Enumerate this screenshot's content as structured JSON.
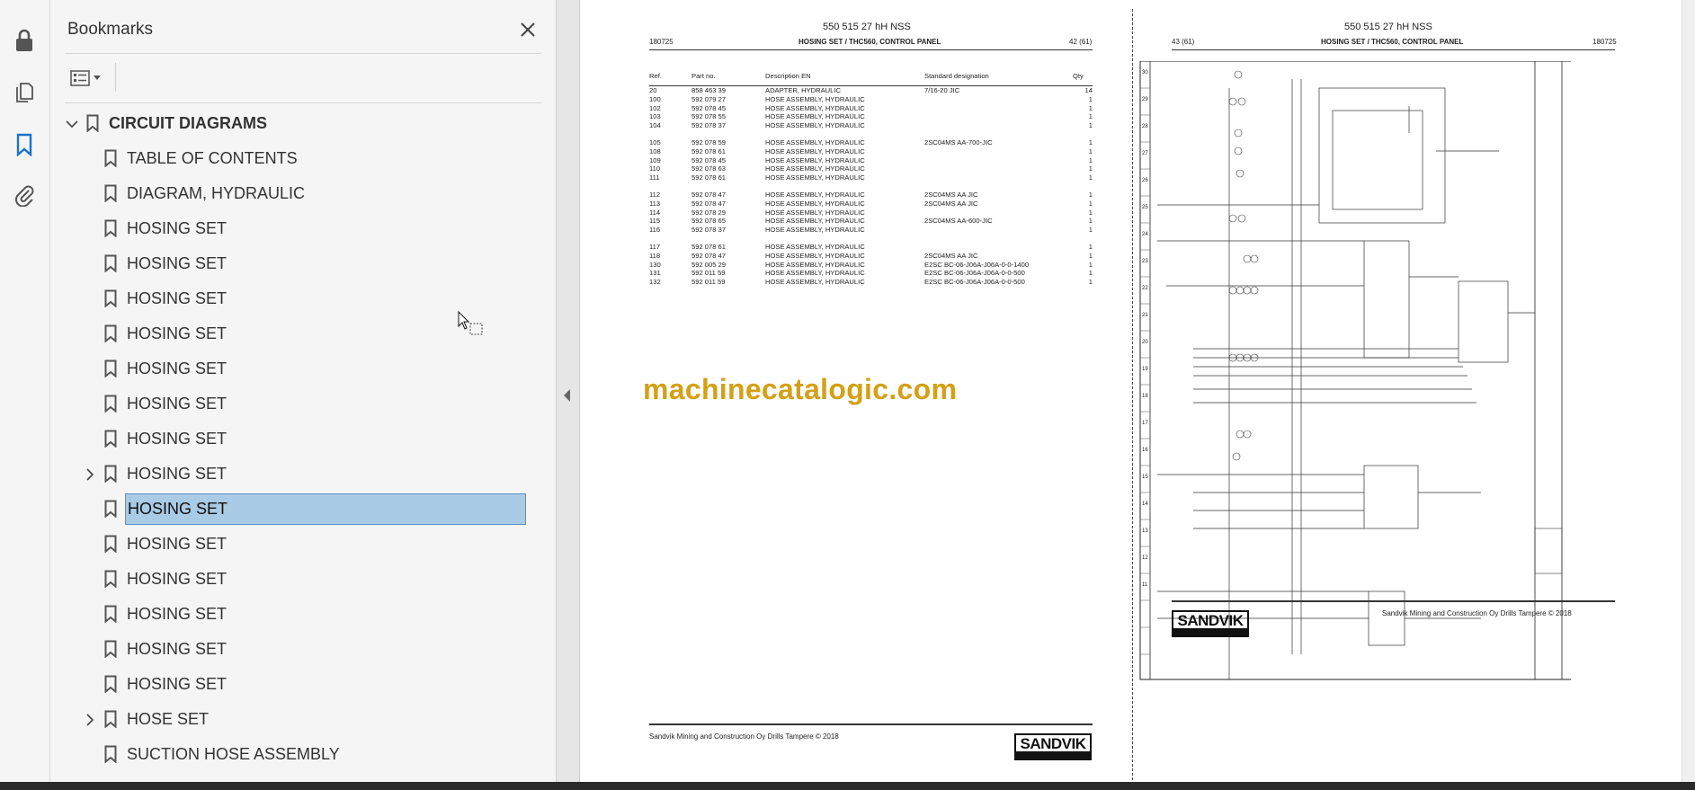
{
  "bookmarks_panel": {
    "title": "Bookmarks",
    "items": [
      {
        "label": "CIRCUIT DIAGRAMS",
        "level": 0,
        "expandable": true,
        "expanded": true
      },
      {
        "label": "TABLE OF CONTENTS",
        "level": 1
      },
      {
        "label": "DIAGRAM, HYDRAULIC",
        "level": 1
      },
      {
        "label": "HOSING SET",
        "level": 1
      },
      {
        "label": "HOSING SET",
        "level": 1
      },
      {
        "label": "HOSING SET",
        "level": 1
      },
      {
        "label": "HOSING SET",
        "level": 1
      },
      {
        "label": "HOSING SET",
        "level": 1
      },
      {
        "label": "HOSING SET",
        "level": 1
      },
      {
        "label": "HOSING SET",
        "level": 1
      },
      {
        "label": "HOSING SET",
        "level": 1,
        "expandable": true
      },
      {
        "label": "HOSING SET",
        "level": 1,
        "selected": true
      },
      {
        "label": "HOSING SET",
        "level": 1
      },
      {
        "label": "HOSING SET",
        "level": 1
      },
      {
        "label": "HOSING SET",
        "level": 1
      },
      {
        "label": "HOSING SET",
        "level": 1
      },
      {
        "label": "HOSING SET",
        "level": 1
      },
      {
        "label": "HOSE SET",
        "level": 1,
        "expandable": true
      },
      {
        "label": "SUCTION HOSE ASSEMBLY",
        "level": 1
      }
    ]
  },
  "page_left": {
    "doc_number": "550 515 27 hH NSS",
    "date": "180725",
    "subtitle": "HOSING SET / THC560, CONTROL PANEL",
    "page": "42 (61)",
    "columns": [
      "Ref.",
      "Part no.",
      "Description EN",
      "Standard designation",
      "Qty"
    ],
    "rows": [
      [
        "20",
        "858 463 39",
        "ADAPTER, HYDRAULIC",
        "7/16-20 JIC",
        "14"
      ],
      [
        "100",
        "592 079 27",
        "HOSE ASSEMBLY, HYDRAULIC",
        "",
        "1"
      ],
      [
        "102",
        "592 078 45",
        "HOSE ASSEMBLY, HYDRAULIC",
        "",
        "1"
      ],
      [
        "103",
        "592 078 55",
        "HOSE ASSEMBLY, HYDRAULIC",
        "",
        "1"
      ],
      [
        "104",
        "592 078 37",
        "HOSE ASSEMBLY, HYDRAULIC",
        "",
        "1"
      ],
      null,
      [
        "105",
        "592 078 59",
        "HOSE ASSEMBLY, HYDRAULIC",
        "2SC04MS AA-700-JIC",
        "1"
      ],
      [
        "108",
        "592 078 61",
        "HOSE ASSEMBLY, HYDRAULIC",
        "",
        "1"
      ],
      [
        "109",
        "592 078 45",
        "HOSE ASSEMBLY, HYDRAULIC",
        "",
        "1"
      ],
      [
        "110",
        "592 078 63",
        "HOSE ASSEMBLY, HYDRAULIC",
        "",
        "1"
      ],
      [
        "111",
        "592 078 61",
        "HOSE ASSEMBLY, HYDRAULIC",
        "",
        "1"
      ],
      null,
      [
        "112",
        "592 078 47",
        "HOSE ASSEMBLY, HYDRAULIC",
        "2SC04MS AA JIC",
        "1"
      ],
      [
        "113",
        "592 078 47",
        "HOSE ASSEMBLY, HYDRAULIC",
        "2SC04MS AA JIC",
        "1"
      ],
      [
        "114",
        "592 078 29",
        "HOSE ASSEMBLY, HYDRAULIC",
        "",
        "1"
      ],
      [
        "115",
        "592 078 65",
        "HOSE ASSEMBLY, HYDRAULIC",
        "2SC04MS AA-600-JIC",
        "1"
      ],
      [
        "116",
        "592 078 37",
        "HOSE ASSEMBLY, HYDRAULIC",
        "",
        "1"
      ],
      null,
      [
        "117",
        "592 078 61",
        "HOSE ASSEMBLY, HYDRAULIC",
        "",
        "1"
      ],
      [
        "118",
        "592 078 47",
        "HOSE ASSEMBLY, HYDRAULIC",
        "2SC04MS AA JIC",
        "1"
      ],
      [
        "130",
        "592 005 29",
        "HOSE ASSEMBLY, HYDRAULIC",
        "E2SC BC-06-J06A-J06A-0-0-1400",
        "1"
      ],
      [
        "131",
        "592 011 59",
        "HOSE ASSEMBLY, HYDRAULIC",
        "E2SC BC-06-J06A-J06A-0-0-500",
        "1"
      ],
      [
        "132",
        "592 011 59",
        "HOSE ASSEMBLY, HYDRAULIC",
        "E2SC BC-06-J06A-J06A-0-0-500",
        "1"
      ]
    ],
    "watermark": "machinecatalogic.com",
    "footer": "Sandvik Mining and Construction Oy Drills Tampere © 2018",
    "logo": "SANDVIK"
  },
  "page_right": {
    "doc_number": "550 515 27 hH NSS",
    "page": "43 (61)",
    "subtitle": "HOSING SET / THC560, CONTROL PANEL",
    "date": "180725",
    "footer": "Sandvik Mining and Construction Oy Drills Tampere © 2018",
    "logo": "SANDVIK"
  },
  "colors": {
    "selection": "#a9cbe6",
    "watermark": "#d4a017",
    "accent": "#1a73c9"
  }
}
